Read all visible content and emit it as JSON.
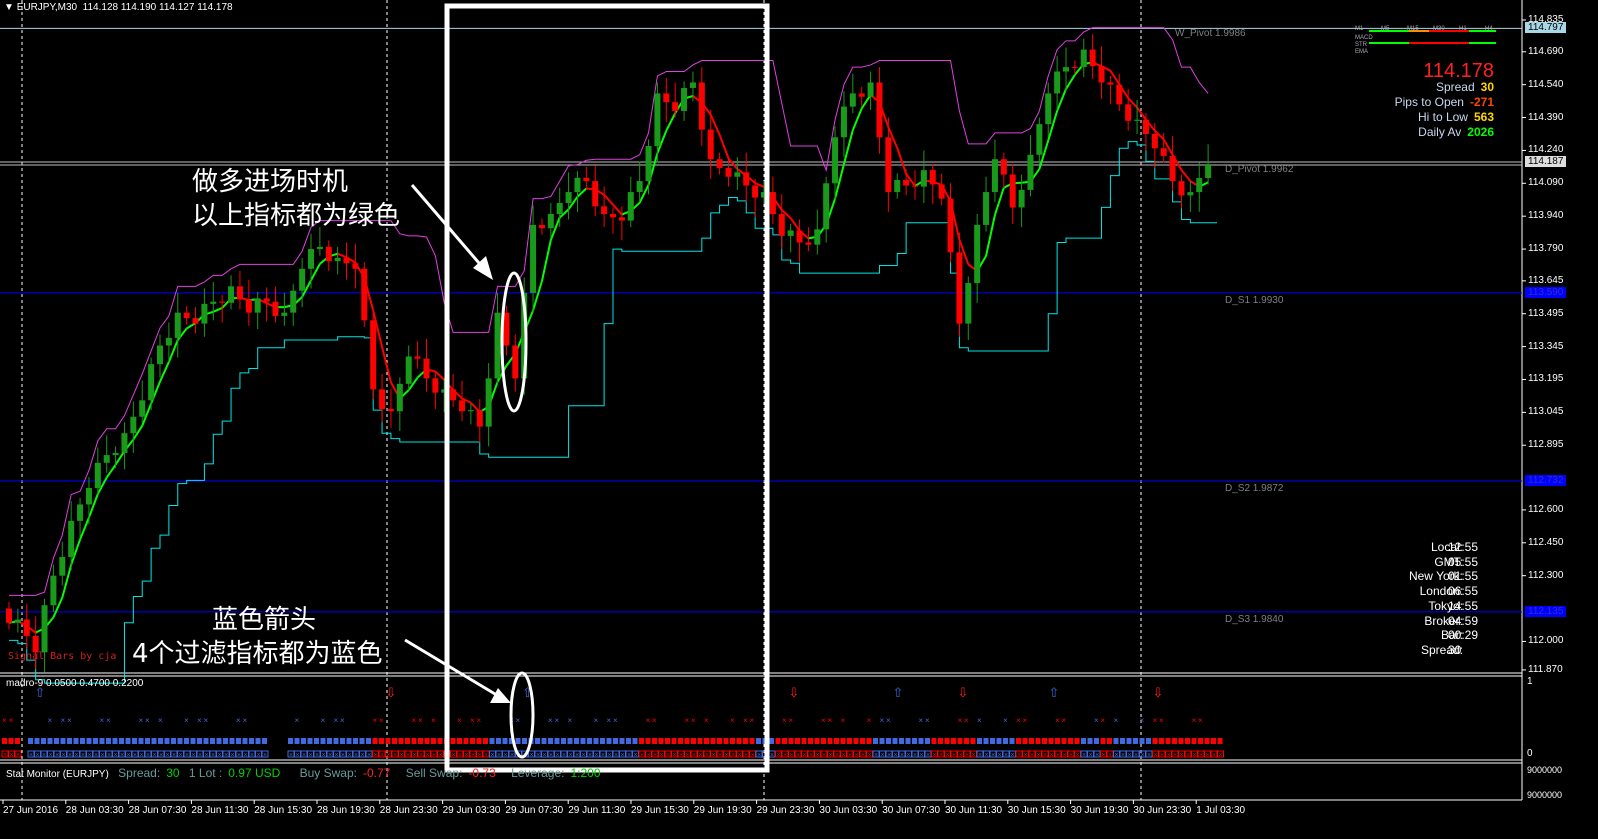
{
  "header": {
    "symbol": "EURJPY,M30",
    "ohlc": "114.128 114.190 114.127 114.178"
  },
  "colors": {
    "bull": "#1a9a1a",
    "bear": "#ff0000",
    "ma_up": "#00ff00",
    "ma_down": "#ff0000",
    "trail": "#00e5e5",
    "upper": "#e040e0",
    "support": "#0000ff"
  },
  "levels": [
    {
      "name": "W_Pivot",
      "label": "W_Pivot 1.9986",
      "price": 114.797,
      "axis": "114.797",
      "color": "#a8d8e8"
    },
    {
      "name": "D_Pivot",
      "label": "D_Pivot 1.9962",
      "price": 114.187,
      "axis": "114.187",
      "color": "#c0c0c0"
    },
    {
      "name": "D_S1",
      "label": "D_S1 1.9930",
      "price": 113.59,
      "axis": "113.590",
      "color": "#0000ff"
    },
    {
      "name": "D_S2",
      "label": "D_S2 1.9872",
      "price": 112.732,
      "axis": "112.732",
      "color": "#0000ff"
    },
    {
      "name": "D_S3",
      "label": "D_S3 1.9840",
      "price": 112.135,
      "axis": "112.135",
      "color": "#0000ff"
    }
  ],
  "chart_data": {
    "type": "candlestick",
    "title": "EURJPY,M30",
    "ylim": [
      111.87,
      114.835
    ],
    "y_ticks": [
      "114.835",
      "114.690",
      "114.540",
      "114.390",
      "114.240",
      "114.090",
      "113.940",
      "113.790",
      "113.645",
      "113.495",
      "113.345",
      "113.195",
      "113.045",
      "112.895",
      "112.600",
      "112.450",
      "112.300",
      "112.000",
      "111.870"
    ],
    "x_ticks": [
      "27 Jun 2016",
      "28 Jun 03:30",
      "28 Jun 07:30",
      "28 Jun 11:30",
      "28 Jun 15:30",
      "28 Jun 19:30",
      "28 Jun 23:30",
      "29 Jun 03:30",
      "29 Jun 07:30",
      "29 Jun 11:30",
      "29 Jun 15:30",
      "29 Jun 19:30",
      "29 Jun 23:30",
      "30 Jun 03:30",
      "30 Jun 07:30",
      "30 Jun 11:30",
      "30 Jun 15:30",
      "30 Jun 19:30",
      "30 Jun 23:30",
      "1 Jul 03:30"
    ],
    "close": [
      112.1,
      111.95,
      112.3,
      112.55,
      112.7,
      112.85,
      112.95,
      113.1,
      113.35,
      113.5,
      113.45,
      113.55,
      113.62,
      113.5,
      113.55,
      113.5,
      113.7,
      113.8,
      113.75,
      113.7,
      113.15,
      113.05,
      113.3,
      113.2,
      113.15,
      113.05,
      112.98,
      113.5,
      113.2,
      113.9,
      113.95,
      114.05,
      114.1,
      113.95,
      113.92,
      114.1,
      114.5,
      114.42,
      114.55,
      114.2,
      114.12,
      114.08,
      114.05,
      113.85,
      113.82,
      113.88,
      114.3,
      114.5,
      114.55,
      114.05,
      114.08,
      114.15,
      114.02,
      113.45,
      113.9,
      114.2,
      113.98,
      114.22,
      114.5,
      114.62,
      114.7,
      114.55,
      114.45,
      114.38,
      114.25,
      114.1,
      114.05,
      114.178
    ]
  },
  "annotations": {
    "long_entry": [
      "做多进场时机",
      "以上指标都为绿色"
    ],
    "blue_arrow": [
      "蓝色箭头",
      "4个过滤指标都为蓝色"
    ],
    "signal_bars": "Signal Bars by cja"
  },
  "panel": {
    "tf_labels": [
      "M1",
      "M5",
      "M15",
      "M30",
      "H1",
      "H4"
    ],
    "rows": [
      "MACD",
      "STR",
      "EMA"
    ],
    "price": "114.178",
    "stats": [
      {
        "label": "Spread",
        "value": "30",
        "color": "#ffd700"
      },
      {
        "label": "Pips to Open",
        "value": "-271",
        "color": "#ff4500"
      },
      {
        "label": "Hi to Low",
        "value": "563",
        "color": "#ffd700"
      },
      {
        "label": "Daily Av",
        "value": "2026",
        "color": "#00ff00"
      }
    ]
  },
  "clock": [
    {
      "label": "Local:",
      "value": "12:55"
    },
    {
      "label": "GMT:",
      "value": "05:55"
    },
    {
      "label": "New York:",
      "value": "01:55"
    },
    {
      "label": "London:",
      "value": "06:55"
    },
    {
      "label": "Tokyo:",
      "value": "14:55"
    },
    {
      "label": "Broker:",
      "value": "04:59"
    },
    {
      "label": "Bar:",
      "value": "00:29"
    },
    {
      "label": "Spread:",
      "value": "30"
    }
  ],
  "indicator": {
    "title": "madro-9 0.0500 0.4700 0.2200",
    "axis_top": "1",
    "axis_bottom": "0",
    "arrows": [
      {
        "dir": "up",
        "bar": 5
      },
      {
        "dir": "down",
        "bar": 59
      },
      {
        "dir": "up",
        "bar": 80
      },
      {
        "dir": "down",
        "bar": 121
      },
      {
        "dir": "up",
        "bar": 137
      },
      {
        "dir": "down",
        "bar": 147
      },
      {
        "dir": "up",
        "bar": 161
      },
      {
        "dir": "down",
        "bar": 177
      }
    ],
    "square_runs": [
      [
        "r",
        3
      ],
      [
        "n",
        1
      ],
      [
        "b",
        37
      ],
      [
        "n",
        3
      ],
      [
        "b",
        13
      ],
      [
        "r",
        18
      ],
      [
        "b",
        23
      ],
      [
        "r",
        18
      ],
      [
        "b",
        3
      ],
      [
        "r",
        15
      ],
      [
        "b",
        9
      ],
      [
        "r",
        7
      ],
      [
        "b",
        6
      ],
      [
        "r",
        10
      ],
      [
        "b",
        3
      ],
      [
        "r",
        2
      ],
      [
        "b",
        6
      ],
      [
        "r",
        11
      ]
    ]
  },
  "stat_monitor": {
    "title": "Stat Monitor (EURJPY)",
    "spread_label": "Spread:",
    "spread": "30",
    "lot_label": "1 Lot :",
    "lot": "0.97 USD",
    "buy_label": "Buy Swap:",
    "buy": "-0.77",
    "sell_label": "Sell Swap:",
    "sell": "-0.73",
    "lev_label": "Leverage:",
    "lev": "1:200",
    "axis_top": "9000000",
    "axis_bottom": "9000000"
  }
}
